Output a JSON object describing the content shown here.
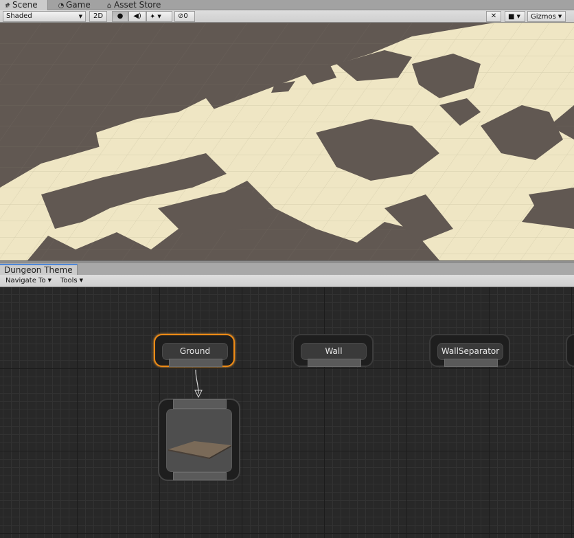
{
  "top_tabs": [
    {
      "label": "Scene",
      "icon": "grid-icon"
    },
    {
      "label": "Game",
      "icon": "pacman-icon"
    },
    {
      "label": "Asset Store",
      "icon": "bag-icon"
    }
  ],
  "scene_toolbar": {
    "shading_mode": "Shaded",
    "mode_2d": "2D",
    "hidden_count": "0",
    "gizmos": "Gizmos"
  },
  "theme_window": {
    "tab_title": "Dungeon Theme",
    "navigate_label": "Navigate To",
    "tools_label": "Tools"
  },
  "nodes": {
    "ground": "Ground",
    "wall": "Wall",
    "wall_separator": "WallSeparator"
  },
  "colors": {
    "selected_outline": "#f08b15",
    "floor": "#efe6c4",
    "void": "#5f5650",
    "graph_bg": "#282828"
  }
}
